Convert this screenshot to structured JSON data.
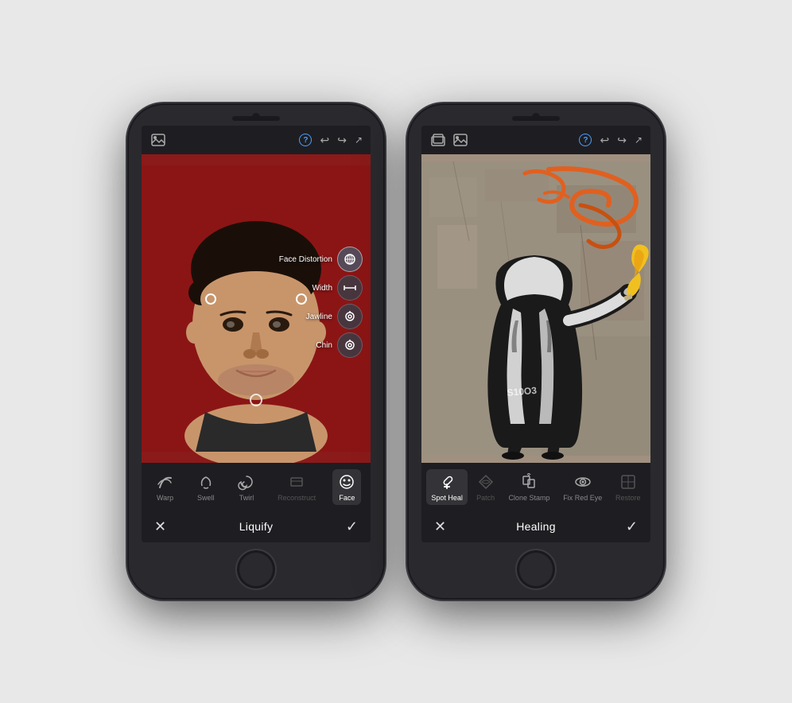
{
  "phones": [
    {
      "id": "liquify-phone",
      "toolbar": {
        "has_layers": false,
        "has_image": true,
        "question_label": "?",
        "undo_label": "↩",
        "redo_label": "↪",
        "expand_label": "↗"
      },
      "face_distortion_menu": {
        "items": [
          {
            "id": "face-distortion",
            "label": "Face Distortion",
            "icon": "⊕",
            "active": true
          },
          {
            "id": "width",
            "label": "Width",
            "icon": "↔",
            "active": false
          },
          {
            "id": "jawline",
            "label": "Jawline",
            "icon": "◎",
            "active": false
          },
          {
            "id": "chin",
            "label": "Chin",
            "icon": "◎",
            "active": false
          }
        ]
      },
      "tools": [
        {
          "id": "warp",
          "label": "Warp",
          "icon": "𝄞",
          "active": false
        },
        {
          "id": "swell",
          "label": "Swell",
          "icon": "⋄",
          "active": false
        },
        {
          "id": "twirl",
          "label": "Twirl",
          "icon": "↺",
          "active": false
        },
        {
          "id": "reconstruct",
          "label": "Reconstruct",
          "icon": "◻",
          "active": false,
          "disabled": true
        },
        {
          "id": "face",
          "label": "Face",
          "icon": "☺",
          "active": true
        }
      ],
      "action_bar": {
        "cancel_label": "✕",
        "title": "Liquify",
        "confirm_label": "✓"
      }
    },
    {
      "id": "healing-phone",
      "toolbar": {
        "has_layers": true,
        "has_image": true,
        "question_label": "?",
        "undo_label": "↩",
        "redo_label": "↪",
        "expand_label": "↗"
      },
      "tools": [
        {
          "id": "spot-heal",
          "label": "Spot Heal",
          "icon": "✚",
          "active": true
        },
        {
          "id": "patch",
          "label": "Patch",
          "icon": "⬡",
          "active": false,
          "disabled": true
        },
        {
          "id": "clone-stamp",
          "label": "Clone Stamp",
          "icon": "⎋",
          "active": false
        },
        {
          "id": "fix-red-eye",
          "label": "Fix Red Eye",
          "icon": "◉",
          "active": false
        },
        {
          "id": "restore",
          "label": "Restore",
          "icon": "◫",
          "active": false,
          "disabled": true
        }
      ],
      "action_bar": {
        "cancel_label": "✕",
        "title": "Healing",
        "confirm_label": "✓"
      }
    }
  ]
}
